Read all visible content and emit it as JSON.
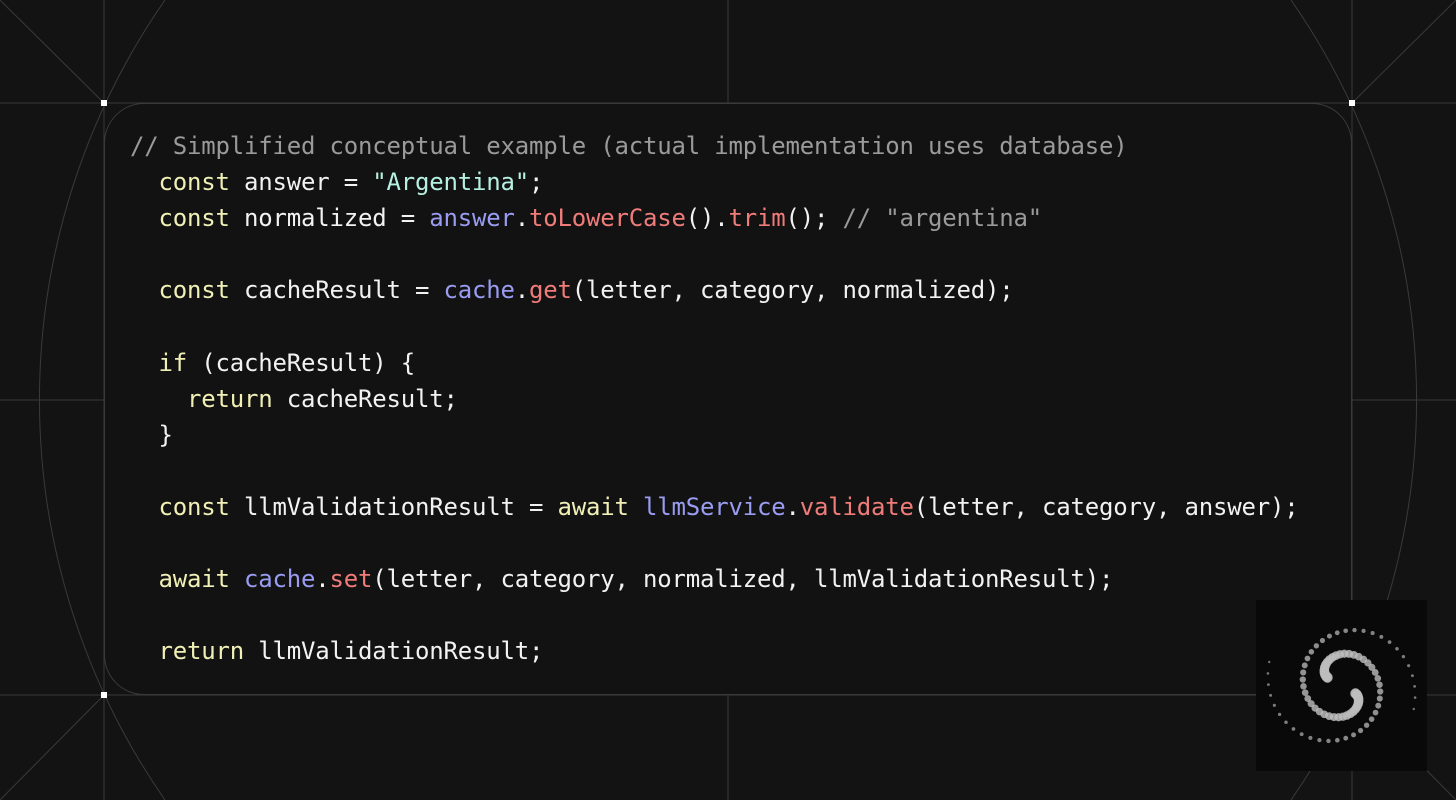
{
  "code_lines": [
    [
      {
        "t": "// Simplified conceptual example (actual implementation uses database)",
        "k": "comment"
      }
    ],
    [
      {
        "t": "  ",
        "k": "plain"
      },
      {
        "t": "const",
        "k": "keyword"
      },
      {
        "t": " answer = ",
        "k": "plain"
      },
      {
        "t": "\"Argentina\"",
        "k": "string"
      },
      {
        "t": ";",
        "k": "plain"
      }
    ],
    [
      {
        "t": "  ",
        "k": "plain"
      },
      {
        "t": "const",
        "k": "keyword"
      },
      {
        "t": " normalized = ",
        "k": "plain"
      },
      {
        "t": "answer",
        "k": "object"
      },
      {
        "t": ".",
        "k": "plain"
      },
      {
        "t": "toLowerCase",
        "k": "method"
      },
      {
        "t": "().",
        "k": "plain"
      },
      {
        "t": "trim",
        "k": "method"
      },
      {
        "t": "(); ",
        "k": "plain"
      },
      {
        "t": "// \"argentina\"",
        "k": "comment"
      }
    ],
    [],
    [
      {
        "t": "  ",
        "k": "plain"
      },
      {
        "t": "const",
        "k": "keyword"
      },
      {
        "t": " cacheResult = ",
        "k": "plain"
      },
      {
        "t": "cache",
        "k": "object"
      },
      {
        "t": ".",
        "k": "plain"
      },
      {
        "t": "get",
        "k": "method"
      },
      {
        "t": "(letter, category, normalized);",
        "k": "plain"
      }
    ],
    [],
    [
      {
        "t": "  ",
        "k": "plain"
      },
      {
        "t": "if",
        "k": "keyword"
      },
      {
        "t": " (cacheResult) {",
        "k": "plain"
      }
    ],
    [
      {
        "t": "    ",
        "k": "plain"
      },
      {
        "t": "return",
        "k": "keyword"
      },
      {
        "t": " cacheResult;",
        "k": "plain"
      }
    ],
    [
      {
        "t": "  }",
        "k": "plain"
      }
    ],
    [],
    [
      {
        "t": "  ",
        "k": "plain"
      },
      {
        "t": "const",
        "k": "keyword"
      },
      {
        "t": " llmValidationResult = ",
        "k": "plain"
      },
      {
        "t": "await",
        "k": "keyword"
      },
      {
        "t": " ",
        "k": "plain"
      },
      {
        "t": "llmService",
        "k": "object"
      },
      {
        "t": ".",
        "k": "plain"
      },
      {
        "t": "validate",
        "k": "method"
      },
      {
        "t": "(letter, category, answer);",
        "k": "plain"
      }
    ],
    [],
    [
      {
        "t": "  ",
        "k": "plain"
      },
      {
        "t": "await",
        "k": "keyword"
      },
      {
        "t": " ",
        "k": "plain"
      },
      {
        "t": "cache",
        "k": "object"
      },
      {
        "t": ".",
        "k": "plain"
      },
      {
        "t": "set",
        "k": "method"
      },
      {
        "t": "(letter, category, normalized, llmValidationResult);",
        "k": "plain"
      }
    ],
    [],
    [
      {
        "t": "  ",
        "k": "plain"
      },
      {
        "t": "return",
        "k": "keyword"
      },
      {
        "t": " llmValidationResult;",
        "k": "plain"
      }
    ]
  ],
  "colors": {
    "background": "#131313",
    "comment": "#9a9a9a",
    "keyword": "#f0efb6",
    "string": "#b6f0e0",
    "object": "#9a9cf2",
    "method": "#f07c7a",
    "plain": "#f2f2f2"
  },
  "logo": {
    "icon": "spiral-dots-logo"
  }
}
